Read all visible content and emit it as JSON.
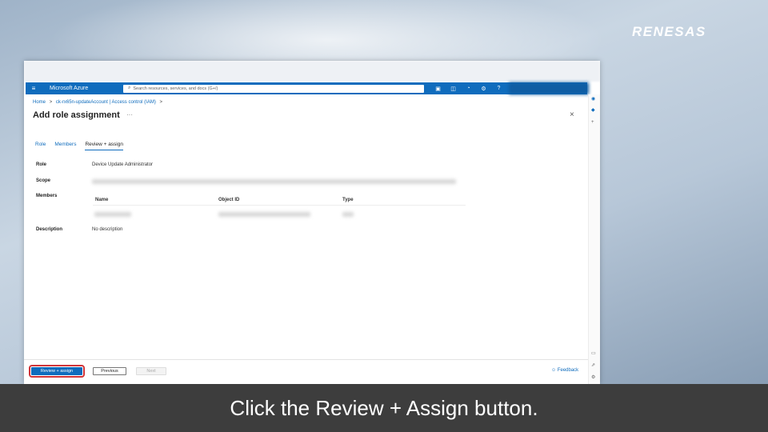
{
  "logo": "RENESAS",
  "topbar": {
    "menu_icon": "≡",
    "brand": "Microsoft Azure",
    "search_placeholder": "Search resources, services, and docs (G+/)",
    "icons": [
      "terminal-icon",
      "copilot-icon",
      "bell-icon",
      "gear-icon",
      "help-icon",
      "person-feedback-icon"
    ]
  },
  "breadcrumb": [
    "Home",
    ">",
    "ck-rx65n-updateAccount | Access control (IAM)",
    ">"
  ],
  "page": {
    "title": "Add role assignment",
    "ellipsis": "···",
    "close": "×"
  },
  "tabs": [
    {
      "label": "Role",
      "active": false
    },
    {
      "label": "Members",
      "active": false
    },
    {
      "label": "Review + assign",
      "active": true
    }
  ],
  "details": {
    "role_label": "Role",
    "role_value": "Device Update Administrator",
    "scope_label": "Scope",
    "members_label": "Members",
    "members_columns": [
      "Name",
      "Object ID",
      "Type"
    ],
    "description_label": "Description",
    "description_value": "No description"
  },
  "footer": {
    "review_assign": "Review + assign",
    "previous": "Previous",
    "next": "Next",
    "feedback": "Feedback"
  },
  "caption": "Click the Review + Assign button.",
  "colors": {
    "azure_blue": "#0f6cbd",
    "highlight_red": "#d13438",
    "caption_bg": "#3d3d3d"
  }
}
